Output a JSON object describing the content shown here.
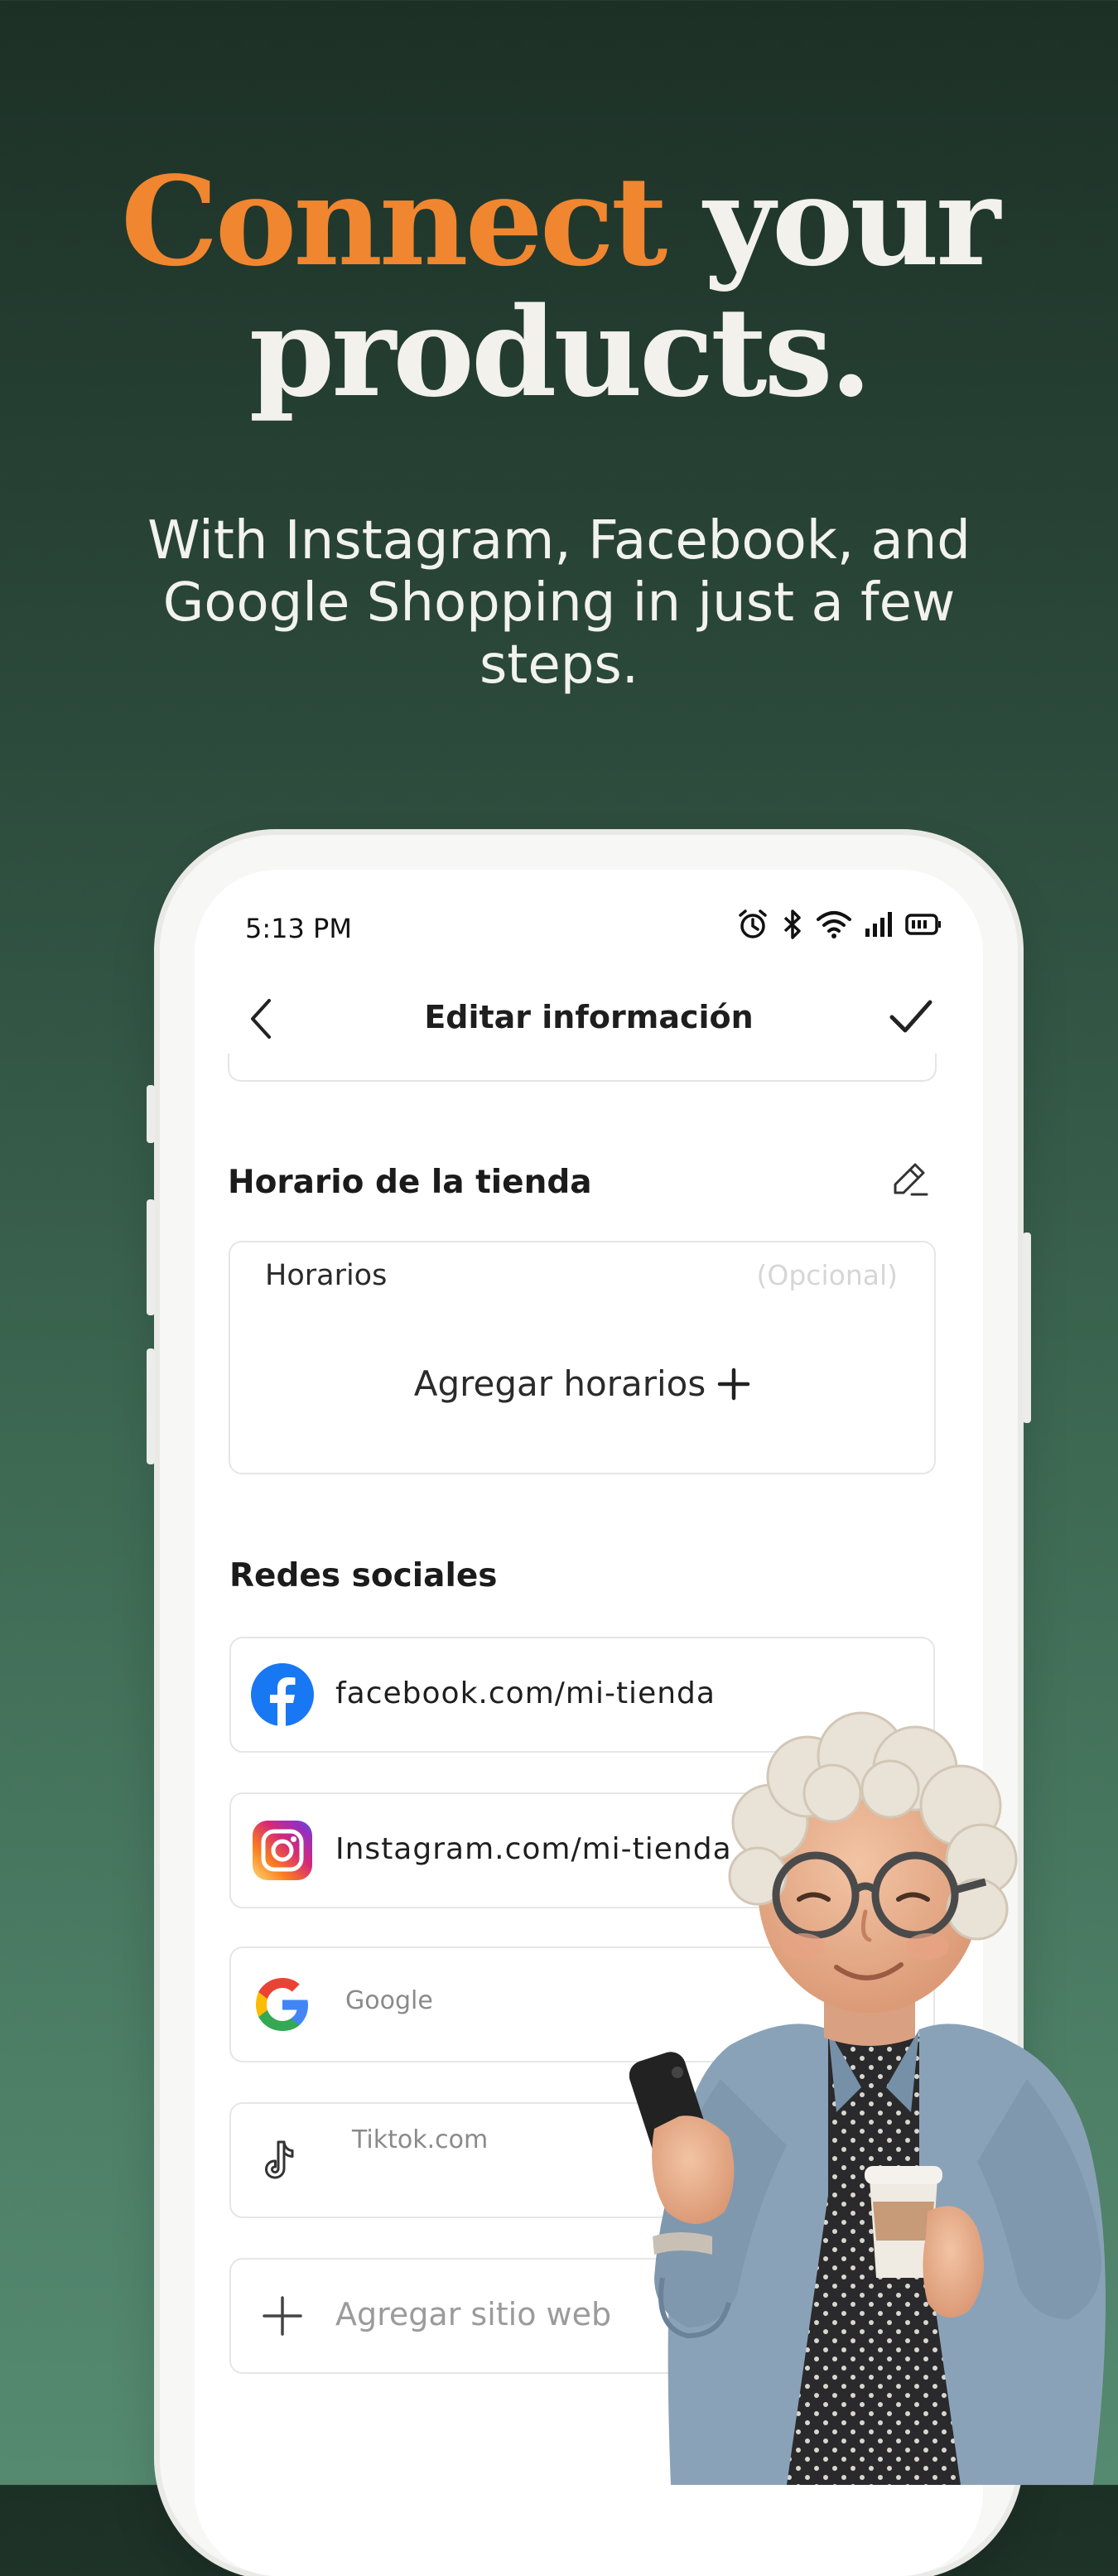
{
  "hero": {
    "headline_accent": "Connect",
    "headline_rest_1": " your",
    "headline_rest_2": "products.",
    "subheadline": "With Instagram, Facebook, and Google Shopping in just a few steps.",
    "accent_color": "#f0862f"
  },
  "status_bar": {
    "time": "5:13 PM",
    "icons": [
      "alarm-icon",
      "bluetooth-icon",
      "wifi-icon",
      "signal-icon",
      "battery-icon"
    ]
  },
  "app_bar": {
    "title": "Editar información",
    "back_icon": "chevron-left-icon",
    "confirm_icon": "check-icon"
  },
  "store_hours": {
    "section_title": "Horario de la tienda",
    "field_label": "Horarios",
    "optional_label": "(Opcional)",
    "add_label": "Agregar horarios",
    "edit_icon": "pencil-icon"
  },
  "social": {
    "section_title": "Redes sociales",
    "items": [
      {
        "icon": "facebook-icon",
        "value": "facebook.com/mi-tienda"
      },
      {
        "icon": "instagram-icon",
        "value": "Instagram.com/mi-tienda"
      },
      {
        "icon": "google-icon",
        "value": "Google"
      },
      {
        "icon": "tiktok-icon",
        "value": "Tiktok.com"
      }
    ],
    "add_website": "Agregar sitio web"
  }
}
